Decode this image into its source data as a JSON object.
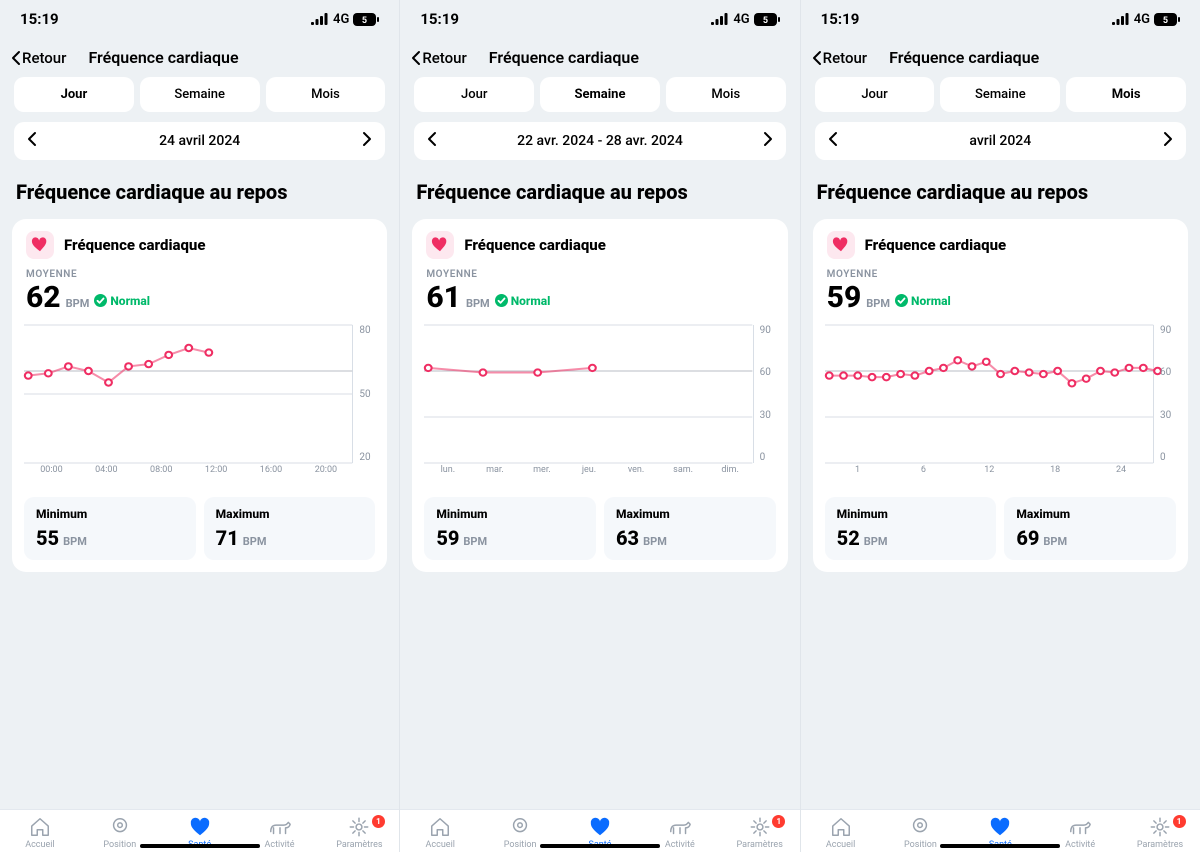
{
  "status": {
    "time": "15:19",
    "network": "4G",
    "battery_level": "5"
  },
  "nav": {
    "back": "Retour",
    "title": "Fréquence cardiaque"
  },
  "tabs": [
    "Jour",
    "Semaine",
    "Mois"
  ],
  "section_title": "Fréquence cardiaque au repos",
  "card": {
    "title": "Fréquence cardiaque",
    "avg_label": "MOYENNE",
    "unit": "BPM",
    "status_text": "Normal",
    "min_label": "Minimum",
    "max_label": "Maximum"
  },
  "bottom_nav": {
    "items": [
      "Accueil",
      "Position",
      "Santé",
      "Activité",
      "Paramètres"
    ],
    "active": 2,
    "badge": "1"
  },
  "screens": [
    {
      "active_tab": 0,
      "date": "24 avril 2024",
      "avg": "62",
      "min": "55",
      "max": "71",
      "chart": {
        "ymin": 20,
        "ymax": 80,
        "avg_line": 60,
        "ticks_y": [
          "80",
          "50",
          "20"
        ],
        "ticks_x": [
          "00:00",
          "04:00",
          "08:00",
          "12:00",
          "16:00",
          "20:00"
        ],
        "points": [
          [
            0,
            58
          ],
          [
            1,
            59
          ],
          [
            2,
            62
          ],
          [
            3,
            60
          ],
          [
            4,
            55
          ],
          [
            5,
            62
          ],
          [
            6,
            63
          ],
          [
            7,
            67
          ],
          [
            8,
            70
          ],
          [
            9,
            68
          ]
        ],
        "x_span": 20,
        "data_span_fraction": 0.55
      }
    },
    {
      "active_tab": 1,
      "date": "22 avr. 2024 - 28 avr. 2024",
      "avg": "61",
      "min": "59",
      "max": "63",
      "chart": {
        "ymin": 0,
        "ymax": 90,
        "avg_line": 60,
        "ticks_y": [
          "90",
          "60",
          "30",
          "0"
        ],
        "ticks_x": [
          "lun.",
          "mar.",
          "mer.",
          "jeu.",
          "ven.",
          "sam.",
          "dim."
        ],
        "points": [
          [
            0,
            62
          ],
          [
            1,
            59
          ],
          [
            2,
            59
          ],
          [
            3,
            62
          ]
        ],
        "x_span": 7,
        "data_span_fraction": 0.5
      }
    },
    {
      "active_tab": 2,
      "date": "avril 2024",
      "avg": "59",
      "min": "52",
      "max": "69",
      "chart": {
        "ymin": 0,
        "ymax": 90,
        "avg_line": 60,
        "ticks_y": [
          "90",
          "60",
          "30",
          "0"
        ],
        "ticks_x": [
          "1",
          "6",
          "12",
          "18",
          "24"
        ],
        "points": [
          [
            0,
            57
          ],
          [
            1,
            57
          ],
          [
            2,
            57
          ],
          [
            3,
            56
          ],
          [
            4,
            56
          ],
          [
            5,
            58
          ],
          [
            6,
            57
          ],
          [
            7,
            60
          ],
          [
            8,
            62
          ],
          [
            9,
            67
          ],
          [
            10,
            63
          ],
          [
            11,
            66
          ],
          [
            12,
            58
          ],
          [
            13,
            60
          ],
          [
            14,
            59
          ],
          [
            15,
            58
          ],
          [
            16,
            60
          ],
          [
            17,
            52
          ],
          [
            18,
            55
          ],
          [
            19,
            60
          ],
          [
            20,
            59
          ],
          [
            21,
            62
          ],
          [
            22,
            62
          ],
          [
            23,
            60
          ]
        ],
        "x_span": 24,
        "data_span_fraction": 1.0
      }
    }
  ],
  "chart_data": [
    {
      "type": "line",
      "title": "Fréquence cardiaque au repos — Jour",
      "ylabel": "BPM",
      "ylim": [
        20,
        80
      ],
      "x": [
        "00:00",
        "01:00",
        "02:00",
        "03:00",
        "04:00",
        "05:00",
        "06:00",
        "07:00",
        "08:00",
        "09:00"
      ],
      "values": [
        58,
        59,
        62,
        60,
        55,
        62,
        63,
        67,
        70,
        68
      ],
      "average": 62
    },
    {
      "type": "line",
      "title": "Fréquence cardiaque au repos — Semaine",
      "ylabel": "BPM",
      "ylim": [
        0,
        90
      ],
      "x": [
        "lun.",
        "mar.",
        "mer.",
        "jeu."
      ],
      "values": [
        62,
        59,
        59,
        62
      ],
      "average": 61
    },
    {
      "type": "line",
      "title": "Fréquence cardiaque au repos — Mois",
      "ylabel": "BPM",
      "ylim": [
        0,
        90
      ],
      "x": [
        1,
        2,
        3,
        4,
        5,
        6,
        7,
        8,
        9,
        10,
        11,
        12,
        13,
        14,
        15,
        16,
        17,
        18,
        19,
        20,
        21,
        22,
        23,
        24
      ],
      "values": [
        57,
        57,
        57,
        56,
        56,
        58,
        57,
        60,
        62,
        67,
        63,
        66,
        58,
        60,
        59,
        58,
        60,
        52,
        55,
        60,
        59,
        62,
        62,
        60
      ],
      "average": 59
    }
  ]
}
